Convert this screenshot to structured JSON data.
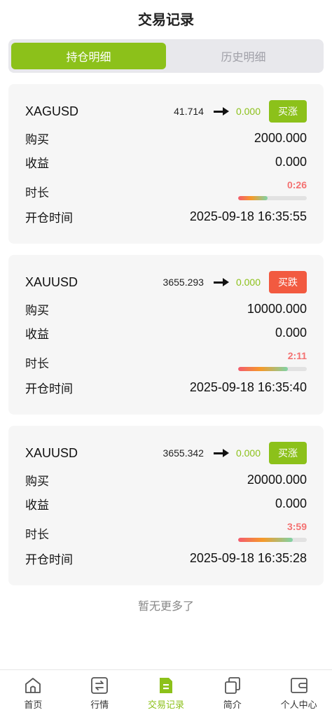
{
  "header": {
    "title": "交易记录"
  },
  "tabs": [
    {
      "label": "持仓明细",
      "active": true
    },
    {
      "label": "历史明细",
      "active": false
    }
  ],
  "labels": {
    "buy": "购买",
    "profit": "收益",
    "duration": "时长",
    "open_time": "开仓时间"
  },
  "orders": [
    {
      "symbol": "XAGUSD",
      "open_price": "41.714",
      "current_price": "0.000",
      "direction_label": "买涨",
      "direction": "up",
      "buy_amount": "2000.000",
      "profit": "0.000",
      "timer": "0:26",
      "progress": 0.43,
      "open_time": "2025-09-18 16:35:55"
    },
    {
      "symbol": "XAUUSD",
      "open_price": "3655.293",
      "current_price": "0.000",
      "direction_label": "买跌",
      "direction": "down",
      "buy_amount": "10000.000",
      "profit": "0.000",
      "timer": "2:11",
      "progress": 0.72,
      "open_time": "2025-09-18 16:35:40"
    },
    {
      "symbol": "XAUUSD",
      "open_price": "3655.342",
      "current_price": "0.000",
      "direction_label": "买涨",
      "direction": "up",
      "buy_amount": "20000.000",
      "profit": "0.000",
      "timer": "3:59",
      "progress": 0.8,
      "open_time": "2025-09-18 16:35:28"
    }
  ],
  "footer_text": "暂无更多了",
  "nav": [
    {
      "label": "首页",
      "icon": "home-icon",
      "active": false
    },
    {
      "label": "行情",
      "icon": "exchange-icon",
      "active": false
    },
    {
      "label": "交易记录",
      "icon": "record-icon",
      "active": true
    },
    {
      "label": "简介",
      "icon": "copy-icon",
      "active": false
    },
    {
      "label": "个人中心",
      "icon": "wallet-icon",
      "active": false
    }
  ],
  "colors": {
    "accent": "#8cc11a",
    "down": "#f25a40",
    "timer": "#f47171"
  }
}
